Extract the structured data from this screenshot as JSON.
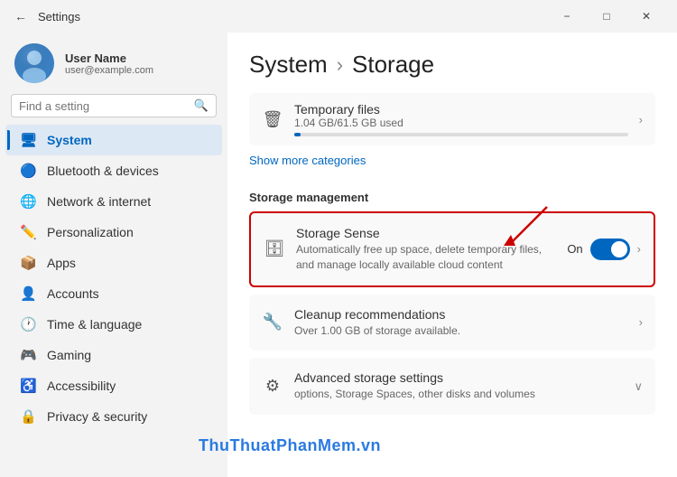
{
  "titleBar": {
    "title": "Settings",
    "minBtn": "−",
    "maxBtn": "□",
    "closeBtn": "✕"
  },
  "sidebar": {
    "profile": {
      "name": "User Name",
      "email": "user@example.com"
    },
    "search": {
      "placeholder": "Find a setting"
    },
    "navItems": [
      {
        "id": "system",
        "label": "System",
        "icon": "🖥",
        "active": true
      },
      {
        "id": "bluetooth",
        "label": "Bluetooth & devices",
        "icon": "🔵"
      },
      {
        "id": "network",
        "label": "Network & internet",
        "icon": "🌐"
      },
      {
        "id": "personalization",
        "label": "Personalization",
        "icon": "✏️"
      },
      {
        "id": "apps",
        "label": "Apps",
        "icon": "📦"
      },
      {
        "id": "accounts",
        "label": "Accounts",
        "icon": "👤"
      },
      {
        "id": "time",
        "label": "Time & language",
        "icon": "🕐"
      },
      {
        "id": "gaming",
        "label": "Gaming",
        "icon": "🎮"
      },
      {
        "id": "accessibility",
        "label": "Accessibility",
        "icon": "♿"
      },
      {
        "id": "privacy",
        "label": "Privacy & security",
        "icon": "🔒"
      }
    ]
  },
  "content": {
    "breadcrumb1": "System",
    "breadcrumb2": "Storage",
    "topBarLabel": "Temporary files",
    "topBarSize": "1.04 GB/61.5 GB used",
    "showMoreLabel": "Show more categories",
    "sectionLabel": "Storage management",
    "items": [
      {
        "id": "storage-sense",
        "icon": "🗄",
        "title": "Storage Sense",
        "desc": "Automatically free up space, delete temporary files, and manage locally available cloud content",
        "toggleLabel": "On",
        "hasToggle": true,
        "hasChevron": true,
        "highlighted": true
      },
      {
        "id": "cleanup",
        "icon": "🔧",
        "title": "Cleanup recommendations",
        "desc": "Over 1.00 GB of storage available.",
        "hasChevron": true,
        "highlighted": false
      },
      {
        "id": "advanced",
        "icon": "⚙",
        "title": "Advanced storage settings",
        "desc": "options, Storage Spaces, other disks and volumes",
        "hasExpand": true,
        "highlighted": false
      }
    ]
  },
  "watermark": "ThuThuatPhanMem",
  "watermarkSuffix": ".vn"
}
